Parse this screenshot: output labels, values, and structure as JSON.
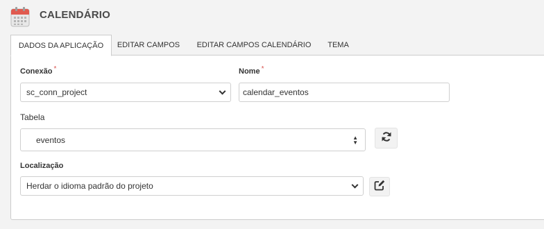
{
  "header": {
    "title": "CALENDÁRIO",
    "icon": "calendar-icon"
  },
  "tabs": [
    {
      "label": "DADOS DA APLICAÇÃO",
      "active": true
    },
    {
      "label": "EDITAR CAMPOS",
      "active": false
    },
    {
      "label": "EDITAR CAMPOS CALENDÁRIO",
      "active": false
    },
    {
      "label": "TEMA",
      "active": false
    }
  ],
  "form": {
    "conexao": {
      "label": "Conexão",
      "required_mark": "*",
      "value": "sc_conn_project"
    },
    "nome": {
      "label": "Nome",
      "required_mark": "*",
      "value": "calendar_eventos"
    },
    "tabela": {
      "label": "Tabela",
      "value": "eventos",
      "refresh_icon": "refresh-icon"
    },
    "localizacao": {
      "label": "Localização",
      "value": "Herdar o idioma padrão do projeto",
      "edit_icon": "edit-icon"
    }
  },
  "colors": {
    "required": "#d9534f",
    "calendar_red": "#e05a4f",
    "border": "#cccccc"
  }
}
